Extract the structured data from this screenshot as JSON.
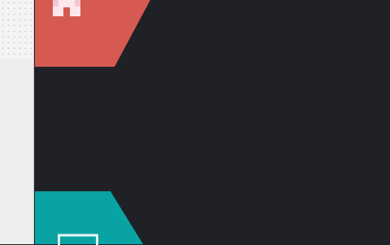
{
  "tiles": [
    {
      "name": "tile-home",
      "icon": "house-icon",
      "color": "#d65a52",
      "icon_color": "#fde7ec"
    },
    {
      "name": "tile-display",
      "icon": "monitor-icon",
      "color": "#0aa3a3",
      "icon_color": "#e6f7f7"
    }
  ],
  "background": "#1f2126",
  "sidebar_color": "#ededee"
}
